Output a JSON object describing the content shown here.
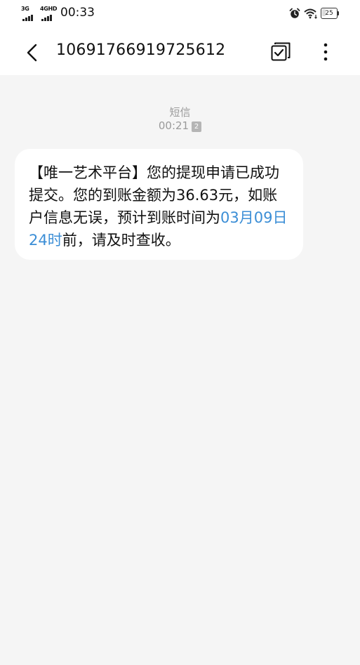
{
  "status_bar": {
    "sim1_label": "3G",
    "sim2_label": "4GHD",
    "time": "00:33",
    "battery_level": 25
  },
  "header": {
    "title": "10691766919725612",
    "back_icon": "chevron-left-icon",
    "select_icon": "multi-select-icon",
    "more_icon": "more-vertical-icon"
  },
  "message": {
    "source": "短信",
    "time": "00:21",
    "sim_badge": "2",
    "text_part1": "【唯一艺术平台】您的提现申请已成功提交。您的到账金额为36.63元，如账户信息无误，预计到账时间为",
    "link_text": "03月09日24时",
    "text_part2": "前，请及时查收。"
  },
  "colors": {
    "background": "#f5f5f5",
    "bubble": "#ffffff",
    "link": "#3b8ed6",
    "meta_text": "#9a9a9a"
  }
}
